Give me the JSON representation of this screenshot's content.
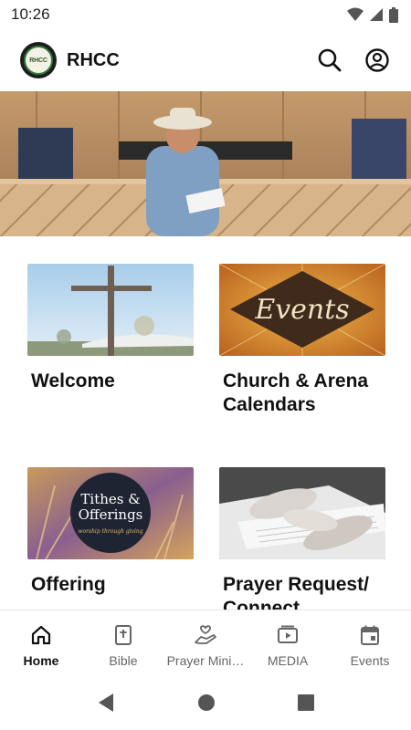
{
  "status": {
    "time": "10:26"
  },
  "app": {
    "title": "RHCC",
    "logo_text": "RHCC"
  },
  "cards": [
    {
      "title": "Welcome"
    },
    {
      "title": "Church & Arena Calendars"
    },
    {
      "title": "Offering",
      "image_text": "Tithes & Offerings",
      "image_subtext": "worship through giving"
    },
    {
      "title": "Prayer Request/ Connect"
    }
  ],
  "events_image_text": "Events",
  "nav": {
    "items": [
      {
        "label": "Home",
        "icon": "home-icon",
        "active": true
      },
      {
        "label": "Bible",
        "icon": "bible-icon"
      },
      {
        "label": "Prayer Mini…",
        "icon": "prayer-hands-icon"
      },
      {
        "label": "MEDIA",
        "icon": "media-icon"
      },
      {
        "label": "Events",
        "icon": "calendar-icon"
      }
    ]
  },
  "colors": {
    "accent": "#111111",
    "inactive": "#666666",
    "logo_green": "#2f7a3a"
  }
}
